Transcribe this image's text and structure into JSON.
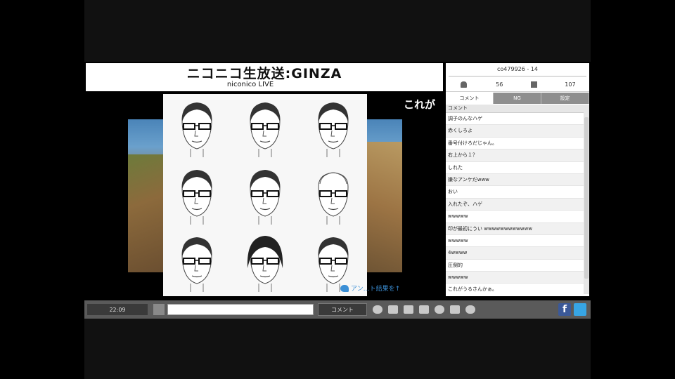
{
  "header": {
    "logo_main": "ニコニコ生放送:GINZA",
    "logo_sub": "niconico LIVE"
  },
  "video": {
    "overlay_text": "これが",
    "caption": "アン…ト結果を↑"
  },
  "room": {
    "id": "co479926 - 14",
    "viewers": "56",
    "comments": "107"
  },
  "tabs": [
    {
      "label": "コメント"
    },
    {
      "label": "NG"
    },
    {
      "label": "設定"
    }
  ],
  "comment_list": {
    "header": "コメント",
    "rows": [
      "調子のんなハゲ",
      "赤くしろよ",
      "番号付けろだじゃん。",
      "右上から１？",
      "しれた",
      "嫌なアンケだwww",
      "おい",
      "入れたぞ、ハゲ",
      "wwwww",
      "印が最初にうい wwwwwwwwwwww",
      "wwwww",
      "4wwww",
      "圧倒的",
      "wwwww",
      "これがうるさんかぁ。"
    ]
  },
  "controls": {
    "time": "22:09",
    "comment_placeholder": "",
    "submit_label": "コメント"
  },
  "social": {
    "facebook_label": "f"
  }
}
